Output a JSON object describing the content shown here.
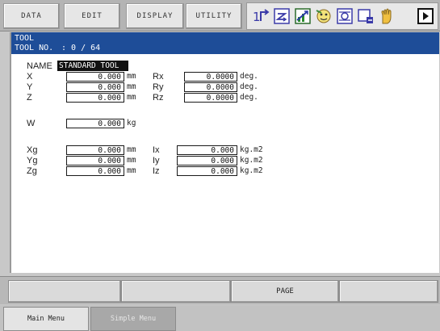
{
  "menu": {
    "data": "DATA",
    "edit": "EDIT",
    "display": "DISPLAY",
    "utility": "UTILITY"
  },
  "status_icons": [
    "step-mode-icon",
    "cycle-icon",
    "servo-status-icon",
    "security-icon",
    "coordinate-icon",
    "play-mode-icon",
    "hand-icon",
    "play-button-icon"
  ],
  "header": {
    "screen_name": "TOOL",
    "tool_no_label": "TOOL NO.",
    "tool_no_value": ": 0 / 64"
  },
  "name": {
    "label": "NAME",
    "value": "STANDARD TOOL"
  },
  "position": {
    "x": {
      "label": "X",
      "value": "0.000",
      "unit": "mm"
    },
    "y": {
      "label": "Y",
      "value": "0.000",
      "unit": "mm"
    },
    "z": {
      "label": "Z",
      "value": "0.000",
      "unit": "mm"
    }
  },
  "rotation": {
    "rx": {
      "label": "Rx",
      "value": "0.0000",
      "unit": "deg."
    },
    "ry": {
      "label": "Ry",
      "value": "0.0000",
      "unit": "deg."
    },
    "rz": {
      "label": "Rz",
      "value": "0.0000",
      "unit": "deg."
    }
  },
  "weight": {
    "label": "W",
    "value": "0.000",
    "unit": "kg"
  },
  "center_of_gravity": {
    "xg": {
      "label": "Xg",
      "value": "0.000",
      "unit": "mm"
    },
    "yg": {
      "label": "Yg",
      "value": "0.000",
      "unit": "mm"
    },
    "zg": {
      "label": "Zg",
      "value": "0.000",
      "unit": "mm"
    }
  },
  "inertia": {
    "ix": {
      "label": "Ix",
      "value": "0.000",
      "unit": "kg.m2"
    },
    "iy": {
      "label": "Iy",
      "value": "0.000",
      "unit": "kg.m2"
    },
    "iz": {
      "label": "Iz",
      "value": "0.000",
      "unit": "kg.m2"
    }
  },
  "function_keys": [
    "",
    "",
    "PAGE",
    ""
  ],
  "bottom": {
    "main_menu": "Main Menu",
    "simple_menu": "Simple Menu"
  },
  "colors": {
    "header_blue": "#1e4d98",
    "name_highlight": "#111111",
    "background": "#ffffff"
  }
}
